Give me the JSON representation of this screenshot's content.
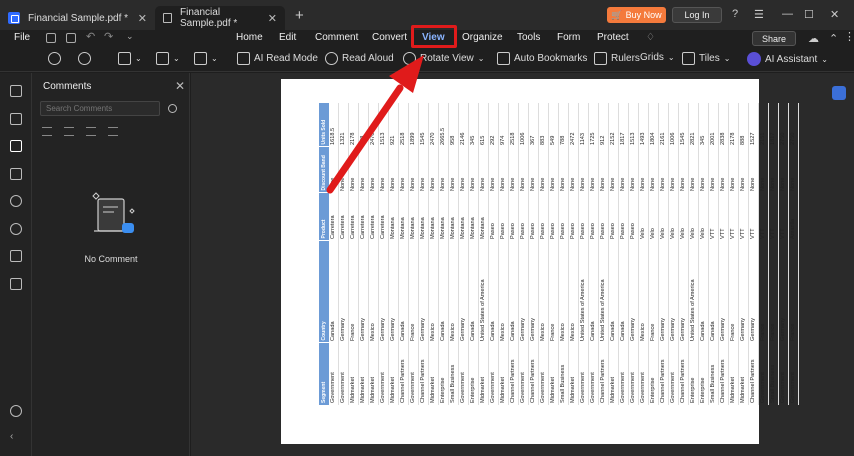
{
  "tabs": [
    {
      "title": "Financial Sample.pdf *",
      "active": false
    },
    {
      "title": "Financial Sample.pdf *",
      "active": true
    }
  ],
  "header": {
    "buy_now": "Buy Now",
    "login": "Log In"
  },
  "menubar": {
    "file": "File",
    "items": [
      "Home",
      "Edit",
      "Comment",
      "Convert",
      "View",
      "Organize",
      "Tools",
      "Form",
      "Protect"
    ],
    "active": "View",
    "share": "Share"
  },
  "toolbar": {
    "ai_read_mode": "AI Read Mode",
    "read_aloud": "Read Aloud",
    "rotate_view": "Rotate View",
    "auto_bookmarks": "Auto Bookmarks",
    "rulers": "Rulers",
    "grids": "Grids",
    "tiles": "Tiles",
    "ai_assistant": "AI Assistant"
  },
  "comments_panel": {
    "title": "Comments",
    "search_placeholder": "Search Comments",
    "empty_text": "No Comment"
  },
  "sheet": {
    "headers": [
      "Segment",
      "Country",
      "Product",
      "Discount Band",
      "Units Sold"
    ],
    "rows": [
      [
        "Government",
        "Canada",
        "Carretera",
        "None",
        "1618.5"
      ],
      [
        "Government",
        "Germany",
        "Carretera",
        "None",
        "1321"
      ],
      [
        "Midmarket",
        "France",
        "Carretera",
        "None",
        "2178"
      ],
      [
        "Midmarket",
        "Germany",
        "Carretera",
        "None",
        "888"
      ],
      [
        "Midmarket",
        "Mexico",
        "Carretera",
        "None",
        "2470"
      ],
      [
        "Government",
        "Germany",
        "Carretera",
        "None",
        "1513"
      ],
      [
        "Midmarket",
        "Germany",
        "Montana",
        "None",
        "921"
      ],
      [
        "Channel Partners",
        "Canada",
        "Montana",
        "None",
        "2518"
      ],
      [
        "Government",
        "France",
        "Montana",
        "None",
        "1899"
      ],
      [
        "Channel Partners",
        "Germany",
        "Montana",
        "None",
        "1545"
      ],
      [
        "Midmarket",
        "Mexico",
        "Montana",
        "None",
        "2470"
      ],
      [
        "Enterprise",
        "Canada",
        "Montana",
        "None",
        "2665.5"
      ],
      [
        "Small Business",
        "Mexico",
        "Montana",
        "None",
        "958"
      ],
      [
        "Government",
        "Germany",
        "Montana",
        "None",
        "2146"
      ],
      [
        "Enterprise",
        "Canada",
        "Montana",
        "None",
        "345"
      ],
      [
        "Midmarket",
        "United States of America",
        "Montana",
        "None",
        "615"
      ],
      [
        "Government",
        "Canada",
        "Paseo",
        "None",
        "292"
      ],
      [
        "Midmarket",
        "Mexico",
        "Paseo",
        "None",
        "974"
      ],
      [
        "Channel Partners",
        "Canada",
        "Paseo",
        "None",
        "2518"
      ],
      [
        "Government",
        "Germany",
        "Paseo",
        "None",
        "1006"
      ],
      [
        "Channel Partners",
        "Germany",
        "Paseo",
        "None",
        "367"
      ],
      [
        "Government",
        "Mexico",
        "Paseo",
        "None",
        "883"
      ],
      [
        "Midmarket",
        "France",
        "Paseo",
        "None",
        "549"
      ],
      [
        "Small Business",
        "Mexico",
        "Paseo",
        "None",
        "788"
      ],
      [
        "Midmarket",
        "Mexico",
        "Paseo",
        "None",
        "2472"
      ],
      [
        "Government",
        "United States of America",
        "Paseo",
        "None",
        "1143"
      ],
      [
        "Government",
        "Canada",
        "Paseo",
        "None",
        "1725"
      ],
      [
        "Channel Partners",
        "United States of America",
        "Paseo",
        "None",
        "912"
      ],
      [
        "Midmarket",
        "Canada",
        "Paseo",
        "None",
        "2152"
      ],
      [
        "Government",
        "Canada",
        "Paseo",
        "None",
        "1817"
      ],
      [
        "Government",
        "Germany",
        "Paseo",
        "None",
        "1513"
      ],
      [
        "Government",
        "Mexico",
        "Velo",
        "None",
        "1493"
      ],
      [
        "Enterprise",
        "France",
        "Velo",
        "None",
        "1804"
      ],
      [
        "Channel Partners",
        "Germany",
        "Velo",
        "None",
        "2161"
      ],
      [
        "Government",
        "Germany",
        "Velo",
        "None",
        "1006"
      ],
      [
        "Channel Partners",
        "Germany",
        "Velo",
        "None",
        "1545"
      ],
      [
        "Enterprise",
        "United States of America",
        "Velo",
        "None",
        "2821"
      ],
      [
        "Enterprise",
        "Canada",
        "Velo",
        "None",
        "345"
      ],
      [
        "Small Business",
        "Canada",
        "VTT",
        "None",
        "2001"
      ],
      [
        "Channel Partners",
        "Germany",
        "VTT",
        "None",
        "2838"
      ],
      [
        "Midmarket",
        "France",
        "VTT",
        "None",
        "2178"
      ],
      [
        "Midmarket",
        "Germany",
        "VTT",
        "None",
        "888"
      ],
      [
        "Channel Partners",
        "Germany",
        "VTT",
        "None",
        "1527"
      ],
      [
        "Government",
        "France",
        "VTT",
        "None",
        "2151"
      ],
      [
        "Small Business",
        "France",
        "VTT",
        "None",
        "1817"
      ],
      [
        "Government",
        "Germany",
        "VTT",
        "None",
        "2750"
      ],
      [
        "Government",
        "France",
        "Amarilla",
        "None",
        "2750"
      ]
    ]
  },
  "colors": {
    "accent": "#4a8cff",
    "highlight": "#e01b1b",
    "buy_now": "#f47a3c",
    "sheet_header": "#6c9bd6"
  }
}
